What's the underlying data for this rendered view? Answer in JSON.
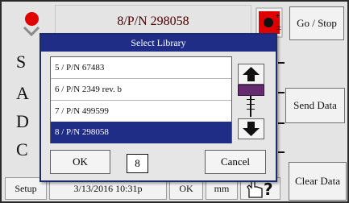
{
  "header": {
    "title": "8/P/N 298058",
    "status_icon": "red-indicator-chevron-icon",
    "calibration_icon": "calibration-flag-icon",
    "go_stop_label": "Go / Stop"
  },
  "side_buttons": {
    "send_data_label": "Send Data",
    "clear_data_label": "Clear Data"
  },
  "background_rows": [
    "S",
    "A",
    "D",
    "C"
  ],
  "footer": {
    "setup_label": "Setup",
    "datetime": "3/13/2016 10:31p",
    "status": "OK",
    "units": "mm",
    "help_icon": "hand-pointer-question-icon"
  },
  "dialog": {
    "title": "Select Library",
    "items": [
      "5 / P/N 67483",
      "6 / P/N 2349 rev. b",
      "7 / P/N 499599",
      "8 / P/N 298058"
    ],
    "selected_index": 3,
    "ok_label": "OK",
    "count": "8",
    "cancel_label": "Cancel"
  },
  "colors": {
    "accent": "#1f2d86",
    "indicator_red": "#e00000",
    "scroll_thumb": "#642b6f"
  }
}
